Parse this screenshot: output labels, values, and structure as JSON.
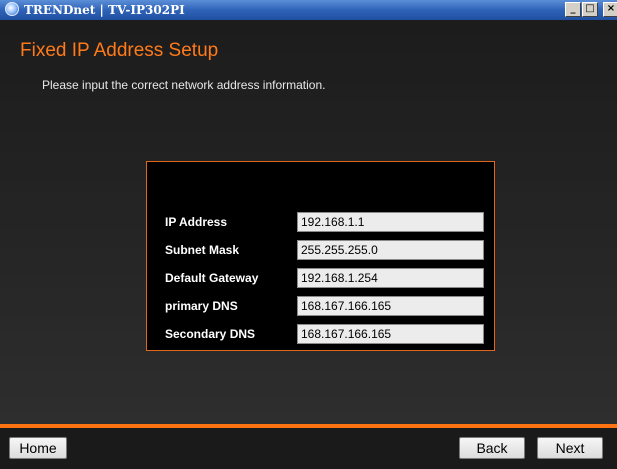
{
  "window": {
    "title": "TRENDnet | TV-IP302PI",
    "minimize_glyph": "_",
    "maximize_glyph": "□",
    "close_glyph": "×"
  },
  "page": {
    "heading": "Fixed IP Address Setup",
    "subtitle": "Please input the correct network address information."
  },
  "form": {
    "fields": [
      {
        "label": "IP Address",
        "value": "192.168.1.1"
      },
      {
        "label": "Subnet Mask",
        "value": "255.255.255.0"
      },
      {
        "label": "Default Gateway",
        "value": "192.168.1.254"
      },
      {
        "label": "primary DNS",
        "value": "168.167.166.165"
      },
      {
        "label": "Secondary DNS",
        "value": "168.167.166.165"
      }
    ]
  },
  "footer": {
    "home_label": "Home",
    "back_label": "Back",
    "next_label": "Next"
  },
  "colors": {
    "accent": "#ff7410",
    "heading": "#ff7a1a",
    "titlebar": "#2f63b8"
  },
  "icons": {
    "title_icon": "trendnet-logo-icon"
  }
}
